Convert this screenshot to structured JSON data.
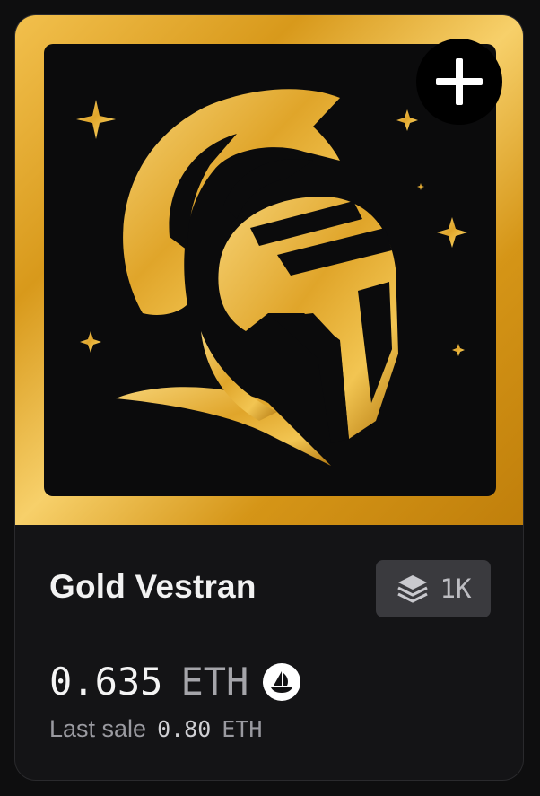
{
  "card": {
    "title": "Gold Vestran",
    "supply": "1K",
    "price_value": "0.635",
    "price_currency": "ETH",
    "last_sale_label": "Last sale",
    "last_sale_value": "0.80",
    "last_sale_currency": "ETH"
  },
  "icons": {
    "add": "plus-icon",
    "supply": "layers-icon",
    "marketplace": "sailboat-icon"
  },
  "colors": {
    "background": "#0e0e0f",
    "card": "#141416",
    "gold": "#e4ad2e",
    "badge": "#3a3a3e"
  }
}
